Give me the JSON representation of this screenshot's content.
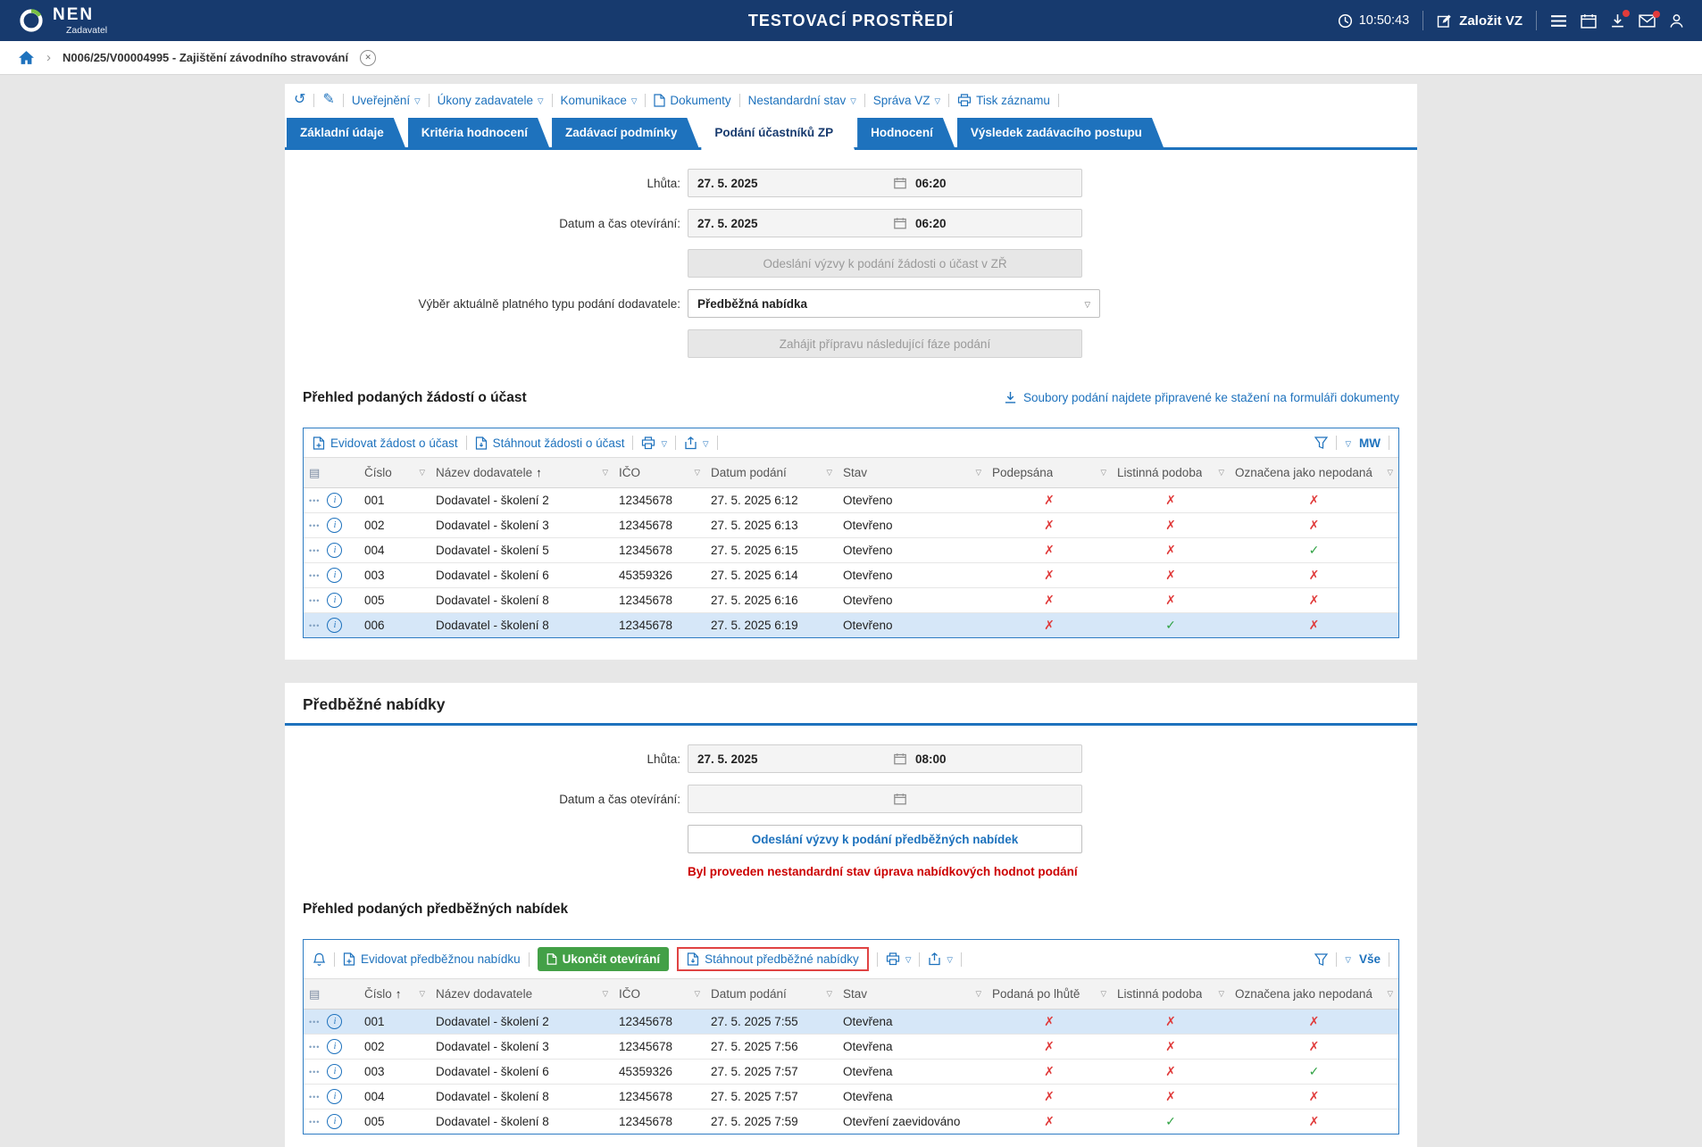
{
  "icons": {
    "undo-icon": "↺",
    "pencil-icon": "✎",
    "dropdown-icon": "▽",
    "sort-asc-icon": "↑",
    "check-icon": "✓",
    "cross-icon": "✗",
    "chevron-icon": "›",
    "close-icon": "✕",
    "dots-icon": "•••",
    "info-icon": "i",
    "grid-icon": "▤"
  },
  "topbar": {
    "brand": "NEN",
    "brand_sub": "Zadavatel",
    "env_title": "TESTOVACÍ PROSTŘEDÍ",
    "time": "10:50:43",
    "create_vz_label": "Založit VZ"
  },
  "breadcrumb": {
    "current": "N006/25/V00004995 - Zajištění závodního stravování"
  },
  "menubar": {
    "uverejneni": "Uveřejnění",
    "ukony_zadavatele": "Úkony zadavatele",
    "komunikace": "Komunikace",
    "dokumenty": "Dokumenty",
    "nestandardni_stav": "Nestandardní stav",
    "sprava_vz": "Správa VZ",
    "tisk_zaznamu": "Tisk záznamu"
  },
  "tabs": [
    {
      "label": "Základní údaje"
    },
    {
      "label": "Kritéria hodnocení"
    },
    {
      "label": "Zadávací podmínky"
    },
    {
      "label": "Podání účastníků ZP"
    },
    {
      "label": "Hodnocení"
    },
    {
      "label": "Výsledek zadávacího postupu"
    }
  ],
  "participation": {
    "lhuta_label": "Lhůta:",
    "lhuta_date": "27. 5. 2025",
    "lhuta_time": "06:20",
    "opening_label": "Datum a čas otevírání:",
    "opening_date": "27. 5. 2025",
    "opening_time": "06:20",
    "send_request_button": "Odeslání výzvy k podání žádosti o účast v ZŘ",
    "type_label": "Výběr aktuálně platného typu podání dodavatele:",
    "type_value": "Předběžná nabídka",
    "next_phase_button": "Zahájit přípravu následující fáze podání",
    "section_title": "Přehled podaných žádostí o účast",
    "files_link": "Soubory podání najdete připravené ke stažení na formuláři dokumenty",
    "toolbar": {
      "evidovat": "Evidovat žádost o účast",
      "stahnout": "Stáhnout žádosti o účast",
      "view": "MW"
    },
    "table": {
      "columns": [
        {
          "key": "cislo",
          "label": "Číslo"
        },
        {
          "key": "nazev-dodavatele",
          "label": "Název dodavatele",
          "sorted": true
        },
        {
          "key": "ico",
          "label": "IČO"
        },
        {
          "key": "datum-podani",
          "label": "Datum podání"
        },
        {
          "key": "stav",
          "label": "Stav"
        },
        {
          "key": "podepsana",
          "label": "Podepsána"
        },
        {
          "key": "listinna-podoba",
          "label": "Listinná podoba"
        },
        {
          "key": "oznacena-jako-nepodana",
          "label": "Označena jako nepodaná"
        }
      ],
      "rows": [
        {
          "cells": [
            "001",
            "Dodavatel - školení 2",
            "12345678",
            "27. 5. 2025 6:12",
            "Otevřeno"
          ],
          "flags": [
            "x",
            "x",
            "x"
          ]
        },
        {
          "cells": [
            "002",
            "Dodavatel - školení 3",
            "12345678",
            "27. 5. 2025 6:13",
            "Otevřeno"
          ],
          "flags": [
            "x",
            "x",
            "x"
          ]
        },
        {
          "cells": [
            "004",
            "Dodavatel - školení 5",
            "12345678",
            "27. 5. 2025 6:15",
            "Otevřeno"
          ],
          "flags": [
            "x",
            "x",
            "check"
          ]
        },
        {
          "cells": [
            "003",
            "Dodavatel - školení 6",
            "45359326",
            "27. 5. 2025 6:14",
            "Otevřeno"
          ],
          "flags": [
            "x",
            "x",
            "x"
          ]
        },
        {
          "cells": [
            "005",
            "Dodavatel - školení 8",
            "12345678",
            "27. 5. 2025 6:16",
            "Otevřeno"
          ],
          "flags": [
            "x",
            "x",
            "x"
          ]
        },
        {
          "cells": [
            "006",
            "Dodavatel - školení 8",
            "12345678",
            "27. 5. 2025 6:19",
            "Otevřeno"
          ],
          "flags": [
            "x",
            "check",
            "x"
          ],
          "selected": true
        }
      ]
    }
  },
  "preliminary": {
    "heading": "Předběžné nabídky",
    "lhuta_label": "Lhůta:",
    "lhuta_date": "27. 5. 2025",
    "lhuta_time": "08:00",
    "opening_label": "Datum a čas otevírání:",
    "send_button": "Odeslání výzvy k podání předběžných nabídek",
    "warning": "Byl proveden nestandardní stav úprava nabídkových hodnot podání",
    "section_title": "Přehled podaných předběžných nabídek",
    "toolbar": {
      "evidovat": "Evidovat předběžnou nabídku",
      "ukoncit": "Ukončit otevírání",
      "stahnout": "Stáhnout předběžné nabídky",
      "view": "Vše"
    },
    "table": {
      "columns": [
        {
          "key": "cislo",
          "label": "Číslo",
          "sorted": true
        },
        {
          "key": "nazev-dodavatele",
          "label": "Název dodavatele"
        },
        {
          "key": "ico",
          "label": "IČO"
        },
        {
          "key": "datum-podani",
          "label": "Datum podání"
        },
        {
          "key": "stav",
          "label": "Stav"
        },
        {
          "key": "podana-po-lhute",
          "label": "Podaná po lhůtě"
        },
        {
          "key": "listinna-podoba",
          "label": "Listinná podoba"
        },
        {
          "key": "oznacena-jako-nepodana",
          "label": "Označena jako nepodaná"
        }
      ],
      "rows": [
        {
          "cells": [
            "001",
            "Dodavatel - školení 2",
            "12345678",
            "27. 5. 2025 7:55",
            "Otevřena"
          ],
          "flags": [
            "x",
            "x",
            "x"
          ],
          "selected": true
        },
        {
          "cells": [
            "002",
            "Dodavatel - školení 3",
            "12345678",
            "27. 5. 2025 7:56",
            "Otevřena"
          ],
          "flags": [
            "x",
            "x",
            "x"
          ]
        },
        {
          "cells": [
            "003",
            "Dodavatel - školení 6",
            "45359326",
            "27. 5. 2025 7:57",
            "Otevřena"
          ],
          "flags": [
            "x",
            "x",
            "check"
          ]
        },
        {
          "cells": [
            "004",
            "Dodavatel - školení 8",
            "12345678",
            "27. 5. 2025 7:57",
            "Otevřena"
          ],
          "flags": [
            "x",
            "x",
            "x"
          ]
        },
        {
          "cells": [
            "005",
            "Dodavatel - školení 8",
            "12345678",
            "27. 5. 2025 7:59",
            "Otevření zaevidováno"
          ],
          "flags": [
            "x",
            "check",
            "x"
          ]
        }
      ]
    }
  }
}
